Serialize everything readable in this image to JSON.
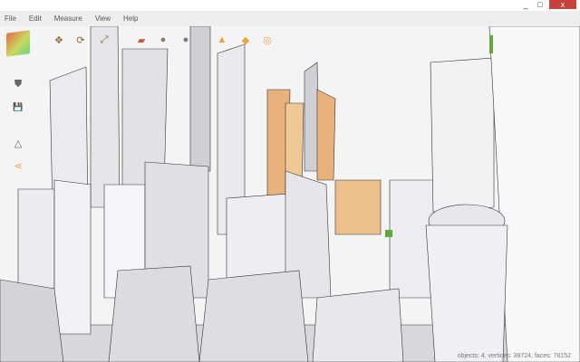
{
  "window": {
    "minimize": "_",
    "maximize": "□",
    "close": "x"
  },
  "menu": [
    "File",
    "Edit",
    "Measure",
    "View",
    "Help"
  ],
  "toolbar": [
    {
      "name": "pan",
      "glyph": "✥"
    },
    {
      "name": "orbit",
      "glyph": "⟳"
    },
    {
      "name": "zoom-extents",
      "glyph": "⤢"
    },
    {
      "name": "material",
      "glyph": "▰"
    },
    {
      "name": "wireframe-sphere",
      "glyph": "●"
    },
    {
      "name": "shaded-sphere",
      "glyph": "●"
    },
    {
      "name": "cone-up",
      "glyph": "▲"
    },
    {
      "name": "cone-down",
      "glyph": "◆"
    },
    {
      "name": "annotate",
      "glyph": "◎"
    }
  ],
  "sidebar": [
    {
      "name": "shield",
      "glyph": "⛊"
    },
    {
      "name": "save",
      "glyph": "💾"
    },
    {
      "name": "drive",
      "glyph": "△"
    },
    {
      "name": "share",
      "glyph": "⋖"
    }
  ],
  "status": "objects: 4, vertices: 38724, faces: 78152",
  "colors": {
    "accent": "#e8a33a",
    "close": "#c9413b"
  }
}
